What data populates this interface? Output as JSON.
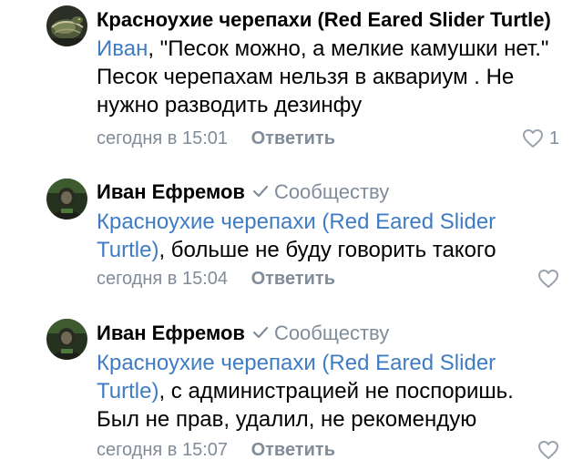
{
  "comments": [
    {
      "author": "Красноухие черепахи (Red Eared Slider Turtle)",
      "mention": "Иван",
      "text_after_mention": ", \"Песок можно, а мелкие камушки нет.\" Песок черепахам нельзя в аквариум . Не нужно разводить дезинфу",
      "time": "сегодня в 15:01",
      "reply": "Ответить",
      "likes": "1"
    },
    {
      "author": "Иван Ефремов",
      "community_label": "Сообществу",
      "mention": "Красноухие черепахи (Red Eared Slider Turtle)",
      "text_after_mention": ", больше не буду говорить такого",
      "time": "сегодня в 15:04",
      "reply": "Ответить"
    },
    {
      "author": "Иван Ефремов",
      "community_label": "Сообществу",
      "mention": "Красноухие черепахи (Red Eared Slider Turtle)",
      "text_after_mention": ", с администрацией не поспоришь. Был не прав, удалил, не рекомендую",
      "time": "сегодня в 15:07",
      "reply": "Ответить"
    }
  ],
  "icons": {
    "like": "heart-outline-icon",
    "verified": "checkmark-icon"
  },
  "colors": {
    "mention": "#2a5885",
    "mention_light": "#3f7cc3",
    "secondary_text": "#818c99",
    "background": "#ffffff"
  }
}
